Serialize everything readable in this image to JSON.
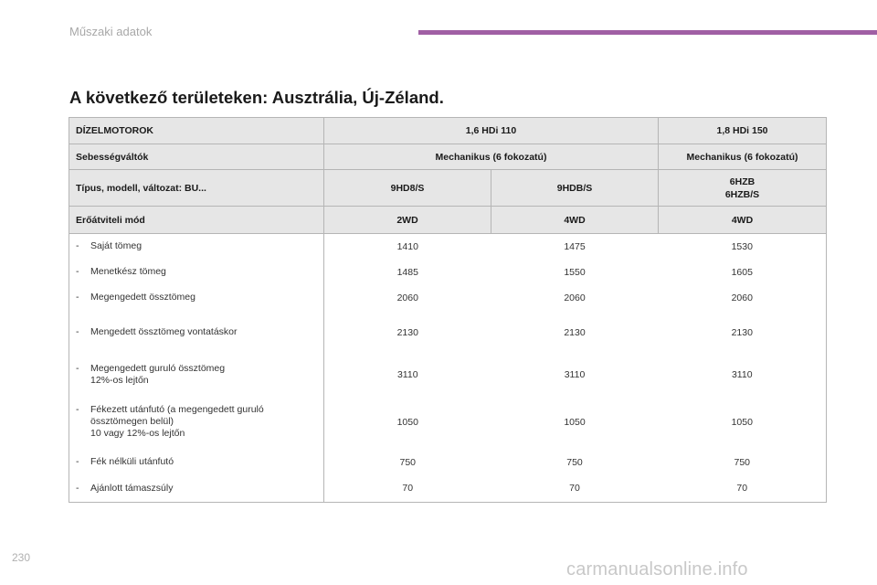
{
  "header": {
    "section": "Műszaki adatok",
    "accent_color": "#a05fa4"
  },
  "title": "A következő területeken: Ausztrália, Új-Zéland.",
  "table": {
    "engine_row": {
      "label": "DÍZELMOTOROK",
      "col1": "1,6 HDi 110",
      "col3": "1,8 HDi 150"
    },
    "gearbox_row": {
      "label": "Sebességváltók",
      "col1": "Mechanikus (6 fokozatú)",
      "col3": "Mechanikus (6 fokozatú)"
    },
    "type_row": {
      "label": "Típus, modell, változat: BU...",
      "col1": "9HD8/S",
      "col2": "9HDB/S",
      "col3": "6HZB\n6HZB/S"
    },
    "drive_row": {
      "label": "Erőátviteli mód",
      "col1": "2WD",
      "col2": "4WD",
      "col3": "4WD"
    },
    "rows": [
      {
        "dash": "-",
        "label": "Saját tömeg",
        "col1": "1410",
        "col2": "1475",
        "col3": "1530"
      },
      {
        "dash": "-",
        "label": "Menetkész tömeg",
        "col1": "1485",
        "col2": "1550",
        "col3": "1605"
      },
      {
        "dash": "-",
        "label": "Megengedett össztömeg",
        "col1": "2060",
        "col2": "2060",
        "col3": "2060"
      },
      {
        "dash": "-",
        "label": "Mengedett össztömeg vontatáskor",
        "col1": "2130",
        "col2": "2130",
        "col3": "2130"
      },
      {
        "dash": "-",
        "label": "Megengedett guruló össztömeg\n12%-os lejtőn",
        "col1": "3110",
        "col2": "3110",
        "col3": "3110"
      },
      {
        "dash": "-",
        "label": "Fékezett utánfutó (a megengedett guruló\nössztömegen belül)\n10 vagy 12%-os lejtőn",
        "col1": "1050",
        "col2": "1050",
        "col3": "1050"
      },
      {
        "dash": "-",
        "label": "Fék nélküli utánfutó",
        "col1": "750",
        "col2": "750",
        "col3": "750"
      },
      {
        "dash": "-",
        "label": "Ajánlott támaszsúly",
        "col1": "70",
        "col2": "70",
        "col3": "70"
      }
    ]
  },
  "footer": {
    "page_number": "230",
    "watermark": "carmanualsonline.info"
  }
}
